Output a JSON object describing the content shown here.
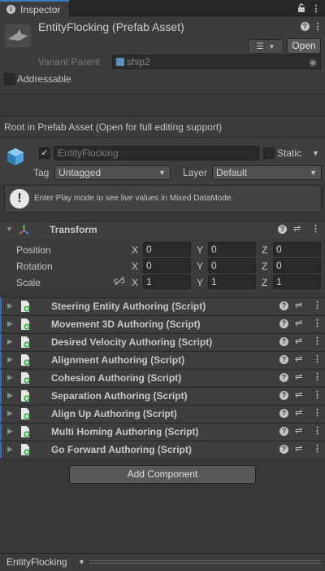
{
  "tab": {
    "title": "Inspector",
    "icon": "info-icon"
  },
  "prefab": {
    "title": "EntityFlocking (Prefab Asset)",
    "open_label": "Open",
    "variant_parent_label": "Variant Parent",
    "variant_parent_value": "ship2",
    "addressable_label": "Addressable"
  },
  "root_note": "Root in Prefab Asset (Open for full editing support)",
  "gameobject": {
    "name": "EntityFlocking",
    "active": "✓",
    "static_label": "Static",
    "tag_label": "Tag",
    "tag_value": "Untagged",
    "layer_label": "Layer",
    "layer_value": "Default"
  },
  "info": {
    "text": "Enter Play mode to see live values in Mixed DataMode."
  },
  "transform": {
    "title": "Transform",
    "position_label": "Position",
    "rotation_label": "Rotation",
    "scale_label": "Scale",
    "axis_x": "X",
    "axis_y": "Y",
    "axis_z": "Z",
    "position": [
      "0",
      "0",
      "0"
    ],
    "rotation": [
      "0",
      "0",
      "0"
    ],
    "scale": [
      "1",
      "1",
      "1"
    ]
  },
  "components": [
    "Steering Entity Authoring (Script)",
    "Movement 3D Authoring (Script)",
    "Desired Velocity Authoring (Script)",
    "Alignment Authoring (Script)",
    "Cohesion Authoring (Script)",
    "Separation Authoring (Script)",
    "Align Up Authoring (Script)",
    "Multi Homing Authoring (Script)",
    "Go Forward Authoring (Script)"
  ],
  "add_component_label": "Add Component",
  "footer": {
    "label": "EntityFlocking"
  },
  "colors": {
    "accent": "#3a79bb",
    "script_stripe": "#3d6db3",
    "background": "#383838"
  }
}
